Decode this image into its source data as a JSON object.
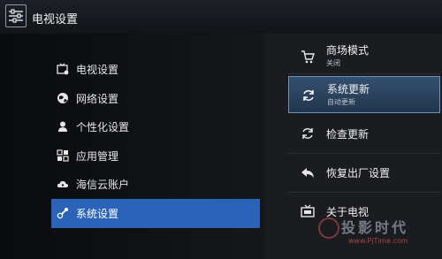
{
  "header": {
    "title": "电视设置"
  },
  "menu": {
    "items": [
      {
        "label": "电视设置",
        "icon": "tv-settings-icon"
      },
      {
        "label": "网络设置",
        "icon": "globe-icon"
      },
      {
        "label": "个性化设置",
        "icon": "person-icon"
      },
      {
        "label": "应用管理",
        "icon": "apps-icon"
      },
      {
        "label": "海信云账户",
        "icon": "cloud-icon"
      },
      {
        "label": "系统设置",
        "icon": "wrench-icon",
        "selected": true
      }
    ]
  },
  "options": {
    "items": [
      {
        "title": "商场模式",
        "sub": "关闭",
        "icon": "cart-icon"
      },
      {
        "title": "系统更新",
        "sub": "自动更新",
        "icon": "refresh-icon",
        "selected": true
      },
      {
        "title": "检查更新",
        "icon": "refresh-icon"
      },
      {
        "title": "恢复出厂设置",
        "icon": "back-arrow-icon"
      },
      {
        "title": "关于电视",
        "icon": "tv-icon"
      }
    ]
  },
  "watermark": {
    "text": "投影时代",
    "url": "www.PjTime.com"
  },
  "colors": {
    "accent": "#2a63b8",
    "selected_option": "#34506f"
  }
}
